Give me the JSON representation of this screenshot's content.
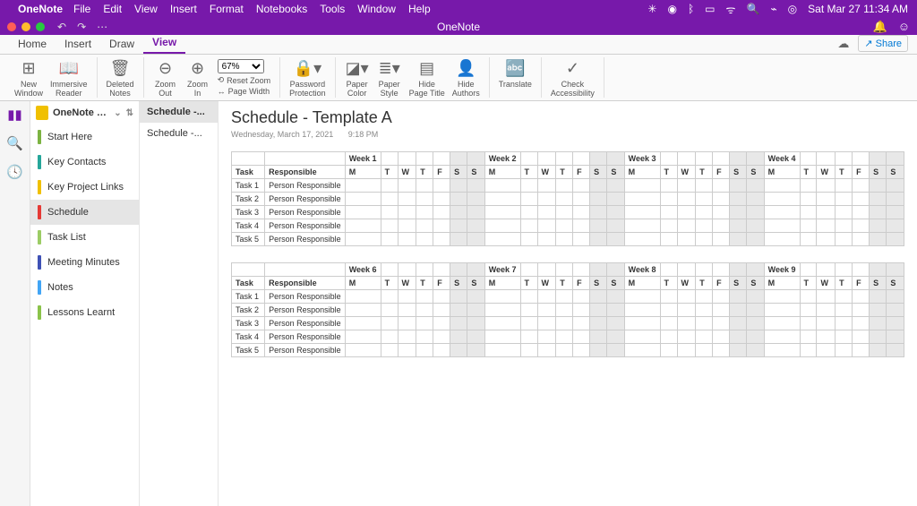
{
  "macmenu": {
    "app": "OneNote",
    "items": [
      "File",
      "Edit",
      "View",
      "Insert",
      "Format",
      "Notebooks",
      "Tools",
      "Window",
      "Help"
    ],
    "datetime": "Sat Mar 27  11:34 AM"
  },
  "titlebar": {
    "title": "OneNote"
  },
  "tabs": {
    "items": [
      "Home",
      "Insert",
      "Draw",
      "View"
    ],
    "active": 3,
    "share": "Share"
  },
  "ribbon": {
    "new_window": "New\nWindow",
    "immersive_reader": "Immersive\nReader",
    "deleted_notes": "Deleted\nNotes",
    "zoom_out": "Zoom\nOut",
    "zoom_in": "Zoom\nIn",
    "zoom_value": "67%",
    "reset_zoom": "Reset Zoom",
    "page_width": "Page Width",
    "password_protection": "Password\nProtection",
    "paper_color": "Paper\nColor",
    "paper_style": "Paper\nStyle",
    "hide_page_title": "Hide\nPage Title",
    "hide_authors": "Hide\nAuthors",
    "translate": "Translate",
    "check_accessibility": "Check\nAccessibility"
  },
  "notebook": {
    "name": "OneNote Template for Pr...",
    "sections": [
      {
        "label": "Start Here",
        "color": "c-grn"
      },
      {
        "label": "Key Contacts",
        "color": "c-teal"
      },
      {
        "label": "Key Project Links",
        "color": "c-yel"
      },
      {
        "label": "Schedule",
        "color": "c-red",
        "selected": true
      },
      {
        "label": "Task List",
        "color": "c-lgrn"
      },
      {
        "label": "Meeting Minutes",
        "color": "c-navy"
      },
      {
        "label": "Notes",
        "color": "c-blue"
      },
      {
        "label": "Lessons Learnt",
        "color": "c-grn2"
      }
    ]
  },
  "pages": [
    {
      "label": "Schedule -...",
      "selected": true
    },
    {
      "label": "Schedule -..."
    }
  ],
  "page": {
    "title": "Schedule - Template A",
    "date": "Wednesday, March 17, 2021",
    "time": "9:18 PM"
  },
  "schedule": {
    "task_hdr": "Task",
    "resp_hdr": "Responsible",
    "days": [
      "M",
      "T",
      "W",
      "T",
      "F",
      "S",
      "S"
    ],
    "table1_weeks": [
      "Week 1",
      "Week 2",
      "Week 3",
      "Week 4"
    ],
    "table2_weeks": [
      "Week 6",
      "Week 7",
      "Week 8",
      "Week 9"
    ],
    "rows": [
      {
        "task": "Task 1",
        "resp": "Person Responsible"
      },
      {
        "task": "Task 2",
        "resp": "Person Responsible"
      },
      {
        "task": "Task 3",
        "resp": "Person Responsible"
      },
      {
        "task": "Task 4",
        "resp": "Person Responsible"
      },
      {
        "task": "Task 5",
        "resp": "Person Responsible"
      }
    ]
  }
}
